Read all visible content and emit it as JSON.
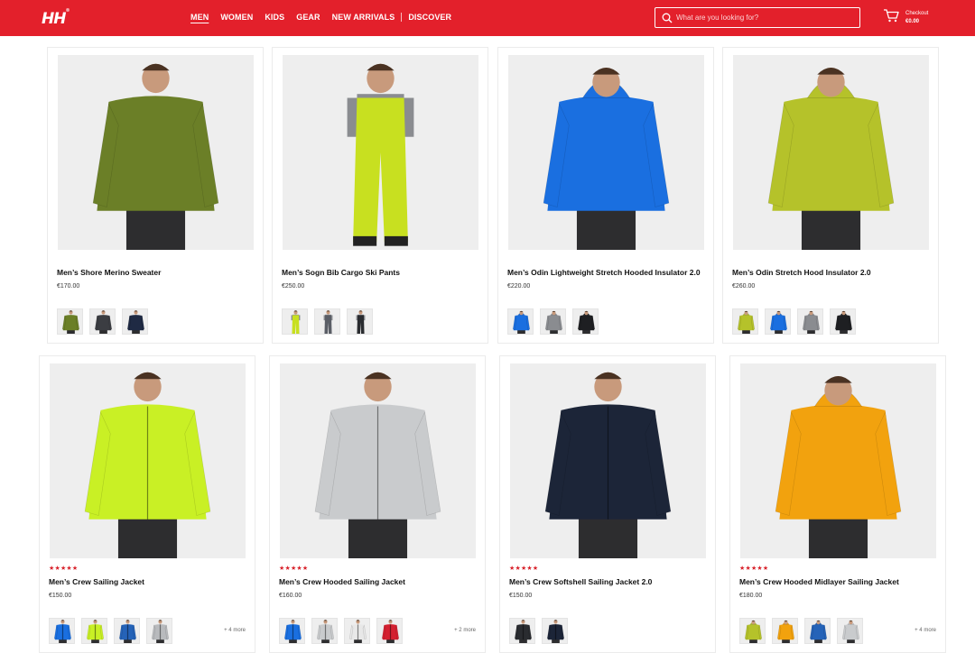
{
  "header": {
    "logo": "HH",
    "logo_mark": "®",
    "nav": [
      "MEN",
      "WOMEN",
      "KIDS",
      "GEAR",
      "NEW ARRIVALS",
      "DISCOVER"
    ],
    "search_placeholder": "What are you looking for?",
    "cart_label": "Checkout",
    "cart_total": "€0.00"
  },
  "products": [
    {
      "name": "Men’s Shore Merino Sweater",
      "price": "€170.00",
      "stars": "",
      "garment": "sweater",
      "color": "#6b7f27",
      "swatch_colors": [
        "#6b7f27",
        "#3b3d42",
        "#1f2a44"
      ],
      "more": ""
    },
    {
      "name": "Men’s Sogn Bib Cargo Ski Pants",
      "price": "€250.00",
      "stars": "",
      "garment": "bib",
      "color": "#c8e020",
      "swatch_colors": [
        "#c8e020",
        "#5a5e66",
        "#2a2c30"
      ],
      "more": ""
    },
    {
      "name": "Men’s Odin Lightweight Stretch Hooded Insulator 2.0",
      "price": "€220.00",
      "stars": "",
      "garment": "hood",
      "color": "#1a6fe0",
      "swatch_colors": [
        "#1a6fe0",
        "#8a8c90",
        "#1e1f22"
      ],
      "more": ""
    },
    {
      "name": "Men’s Odin Stretch Hood Insulator 2.0",
      "price": "€260.00",
      "stars": "",
      "garment": "hood",
      "color": "#b5c22a",
      "swatch_colors": [
        "#b5c22a",
        "#1a6fe0",
        "#8a8c90",
        "#1e1f22"
      ],
      "more": ""
    },
    {
      "name": "Men’s Crew Sailing Jacket",
      "price": "€150.00",
      "stars": "★★★★★",
      "garment": "jacket",
      "color": "#c9f025",
      "swatch_colors": [
        "#1a6fe0",
        "#c9f025",
        "#2563b8",
        "#b8babd"
      ],
      "more": "+ 4 more"
    },
    {
      "name": "Men’s Crew Hooded Sailing Jacket",
      "price": "€160.00",
      "stars": "★★★★★",
      "garment": "jacket",
      "color": "#c9cbcd",
      "swatch_colors": [
        "#1a6fe0",
        "#c9cbcd",
        "#e8e8e8",
        "#d42030"
      ],
      "more": "+ 2 more"
    },
    {
      "name": "Men’s Crew Softshell Sailing Jacket 2.0",
      "price": "€150.00",
      "stars": "★★★★★",
      "garment": "jacket",
      "color": "#1c2538",
      "swatch_colors": [
        "#2a2c30",
        "#1c2538"
      ],
      "more": ""
    },
    {
      "name": "Men’s Crew Hooded Midlayer Sailing Jacket",
      "price": "€180.00",
      "stars": "★★★★★",
      "garment": "hood",
      "color": "#f2a20e",
      "swatch_colors": [
        "#b5c22a",
        "#f2a20e",
        "#2563b8",
        "#c9cbcd"
      ],
      "more": "+ 4 more"
    }
  ]
}
